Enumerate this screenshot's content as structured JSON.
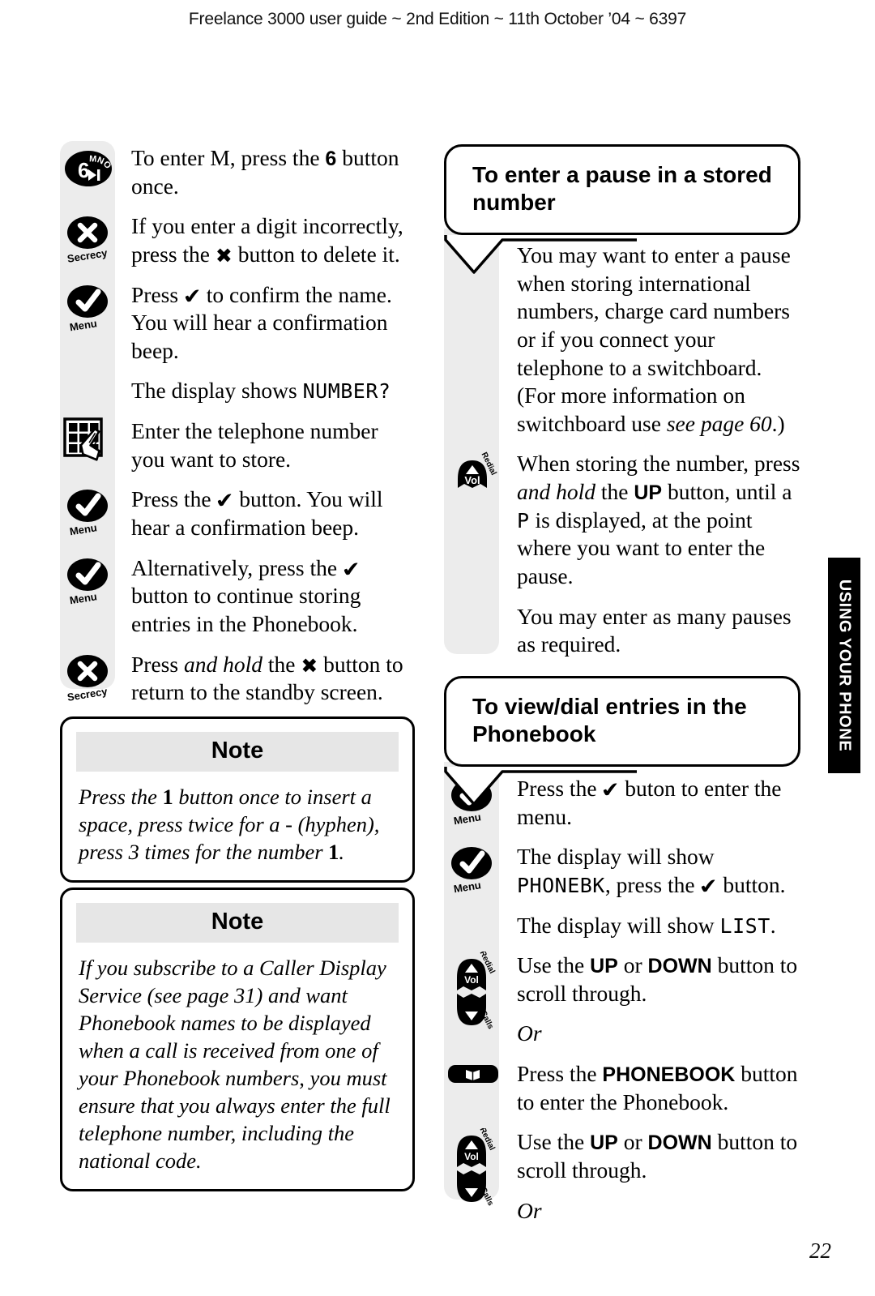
{
  "header": {
    "running_head": "Freelance 3000 user guide ~ 2nd Edition ~ 11th October ’04 ~ 6397"
  },
  "page": {
    "number": "22",
    "thumb_tab": "USING YOUR PHONE"
  },
  "left_column": {
    "steps": [
      {
        "icon": "key-6-mno-icon",
        "icon_labels": {
          "digit": "6",
          "letters": "MNO"
        },
        "text_html": "To enter M, press the <b class=\"bld\">6</b> button once."
      },
      {
        "icon": "secrecy-cross-button-icon",
        "icon_labels": {
          "caption": "Secrecy"
        },
        "text_html": "If you enter a digit incorrectly, press the <span class=\"cross-glyph\">&#10006;</span> button to delete it."
      },
      {
        "icon": "menu-tick-button-icon",
        "icon_labels": {
          "caption": "Menu"
        },
        "text_html": "Press <span class=\"tick-glyph\">&#10004;</span> to confirm the name. You will hear a confirmation beep."
      },
      {
        "icon": "",
        "icon_labels": {},
        "text_html": "The display shows <span class=\"lcd\">NUMBER?</span>"
      },
      {
        "icon": "keypad-grid-hand-icon",
        "icon_labels": {},
        "text_html": "Enter the telephone number you want to store."
      },
      {
        "icon": "menu-tick-button-icon",
        "icon_labels": {
          "caption": "Menu"
        },
        "text_html": "Press the <span class=\"tick-glyph\">&#10004;</span> button. You will hear a confirmation beep."
      },
      {
        "icon": "menu-tick-button-icon",
        "icon_labels": {
          "caption": "Menu"
        },
        "text_html": "Alternatively, press the <span class=\"tick-glyph\">&#10004;</span> button to continue storing entries in the Phonebook."
      },
      {
        "icon": "secrecy-cross-button-icon",
        "icon_labels": {
          "caption": "Secrecy"
        },
        "text_html": "Press <i class=\"itl\">and hold</i> the <span class=\"cross-glyph\">&#10006;</span> button to return to the standby screen."
      }
    ],
    "notes": [
      {
        "title": "Note",
        "text_html": "Press the <b>1</b> button once to insert a space, press twice for a - (hyphen), press 3 times for the number <b>1</b>."
      },
      {
        "title": "Note",
        "text_html": "If you subscribe to a Caller Display Service (see page 31) and want Phonebook names to be displayed when a call is received from one of your Phonebook numbers, you must ensure that you always enter the full telephone number, including the national code."
      }
    ]
  },
  "right_column": {
    "sections": [
      {
        "heading": "To enter a pause in a stored number",
        "steps": [
          {
            "icon": "",
            "icon_labels": {},
            "text_html": "You may want to enter a pause when storing international numbers, charge card numbers or if you connect your telephone to a switchboard. (For more information on switchboard use <i class=\"itl\">see page 60</i>.)"
          },
          {
            "icon": "vol-up-redial-button-icon",
            "icon_labels": {
              "caption": "Vol",
              "side": "Redial"
            },
            "text_html": "When storing the number, press <i class=\"itl\">and hold</i> the <b class=\"bld\">UP</b> button, until a <span class=\"lcd\">P</span> is displayed, at the point where you want to enter the pause."
          },
          {
            "icon": "",
            "icon_labels": {},
            "text_html": "You may enter as many pauses as required."
          }
        ]
      },
      {
        "heading": "To view/dial entries in the Phonebook",
        "steps": [
          {
            "icon": "menu-tick-button-icon",
            "icon_labels": {
              "caption": "Menu"
            },
            "text_html": "Press the <span class=\"tick-glyph\">&#10004;</span> buton to enter the menu."
          },
          {
            "icon": "menu-tick-button-icon",
            "icon_labels": {
              "caption": "Menu"
            },
            "text_html": "The display will show <span class=\"lcd\">PHONEBK</span>, press the <span class=\"tick-glyph\">&#10004;</span> button."
          },
          {
            "icon": "",
            "icon_labels": {},
            "text_html": "The display will show <span class=\"lcd\">LIST</span>."
          },
          {
            "icon": "vol-updown-rocker-icon",
            "icon_labels": {
              "caption": "Vol",
              "top_side": "Redial",
              "bottom_side": "Calls"
            },
            "text_html": "Use the <b class=\"bld\">UP</b> or <b class=\"bld\">DOWN</b> button to scroll through."
          },
          {
            "icon": "",
            "icon_labels": {},
            "text_html": "<i class=\"itl\">Or</i>"
          },
          {
            "icon": "phonebook-book-button-icon",
            "icon_labels": {},
            "text_html": "Press the <b class=\"bld\">PHONEBOOK</b> button to enter the Phonebook."
          },
          {
            "icon": "vol-updown-rocker-icon",
            "icon_labels": {
              "caption": "Vol",
              "top_side": "Redial",
              "bottom_side": "Calls"
            },
            "text_html": "Use the <b class=\"bld\">UP</b> or <b class=\"bld\">DOWN</b> button to scroll through."
          },
          {
            "icon": "",
            "icon_labels": {},
            "text_html": "<i class=\"itl\">Or</i>"
          }
        ]
      }
    ]
  },
  "colors": {
    "rail_gray": "#ececec",
    "note_header_gray": "#e6e6e6",
    "ink": "#000000",
    "paper": "#ffffff"
  }
}
